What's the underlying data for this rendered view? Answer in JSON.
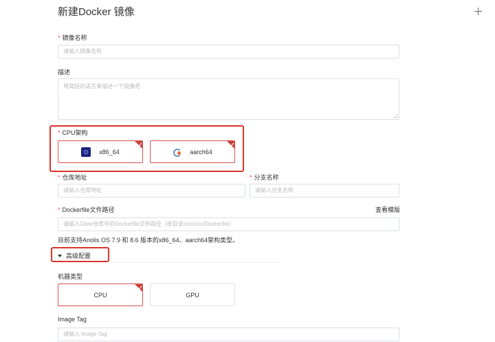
{
  "page": {
    "title": "新建Docker 镜像"
  },
  "form": {
    "image_name": {
      "label": "镜像名称",
      "required_mark": "*",
      "placeholder": "请输入镜像名称"
    },
    "description": {
      "label": "描述",
      "placeholder": "用简短的语言来描述一下镜像吧"
    },
    "cpu_arch": {
      "label": "CPU架构",
      "required_mark": "*",
      "options": [
        {
          "label": "x86_64",
          "icon": "intel-icon",
          "selected": true
        },
        {
          "label": "aarch64",
          "icon": "arm-icon",
          "selected": true
        }
      ]
    },
    "repo": {
      "label": "仓库地址",
      "required_mark": "*",
      "placeholder": "请输入仓库地址"
    },
    "branch": {
      "label": "分支名称",
      "required_mark": "*",
      "placeholder": "请输入分支名称"
    },
    "dockerfile": {
      "label": "Dockerfile文件路径",
      "required_mark": "*",
      "link": "查看模版",
      "placeholder": "请输入Gitee仓库中的Dockerfile文件路径（根目录/xxx/xxx/Dockerfile）"
    },
    "support_hint": "目前支持Anolis OS 7.9 和 8.6 版本的x86_64、aarch64架构类型。",
    "advanced": {
      "toggle_label": "高级配置",
      "machine_type": {
        "label": "机器类型",
        "options": [
          {
            "label": "CPU",
            "selected": true
          },
          {
            "label": "GPU",
            "selected": false
          }
        ]
      },
      "image_tag": {
        "label": "Image Tag",
        "placeholder": "请输入 Image Tag"
      }
    }
  },
  "colors": {
    "accent_red": "#d9342b",
    "border": "#dcdfe6",
    "placeholder": "#bbbbbb"
  }
}
